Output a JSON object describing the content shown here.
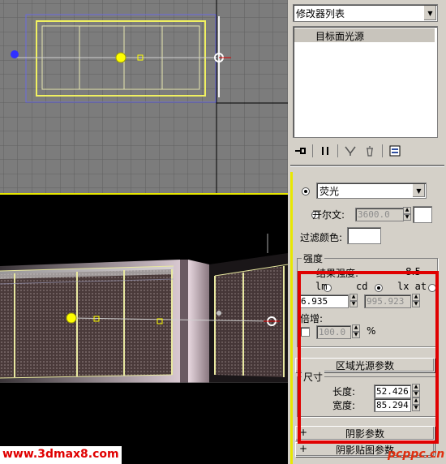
{
  "modifier_list": {
    "label": "修改器列表"
  },
  "stack": {
    "items": [
      "目标面光源"
    ]
  },
  "toolbar": {
    "icons": [
      "pin-stack-icon",
      "show-end-result-icon",
      "make-unique-icon",
      "remove-modifier-icon",
      "configure-modifier-sets-icon"
    ]
  },
  "color": {
    "preset_value": "荧光",
    "kelvin_label": "开尔文:",
    "kelvin_value": "3600.0",
    "filter_label": "过滤颜色:"
  },
  "intensity": {
    "title": "强度",
    "result_label": "结果强度:",
    "result_value": "8.5",
    "units": [
      "lm",
      "cd",
      "lx at"
    ],
    "selected_unit": "cd",
    "value": "6.935",
    "distance": "995.923",
    "multiplier_label": "倍增:",
    "multiplier_value": "100.0",
    "percent": "%"
  },
  "area_rollout": {
    "title": "区域光源参数"
  },
  "size": {
    "title": "尺寸",
    "length_label": "长度:",
    "length_value": "52.426",
    "width_label": "宽度:",
    "width_value": "85.294"
  },
  "shadow_rollout": {
    "title": "阴影参数",
    "sign": "+"
  },
  "shadow_map_rollout": {
    "title": "阴影贴图参数",
    "sign": "+"
  },
  "watermarks": {
    "left": "www.3dmax8.com",
    "right": "pcppc.cn"
  },
  "colors": {
    "highlight": "#e00000",
    "viewport_active": "#e8e800",
    "light": "#ffff00"
  }
}
